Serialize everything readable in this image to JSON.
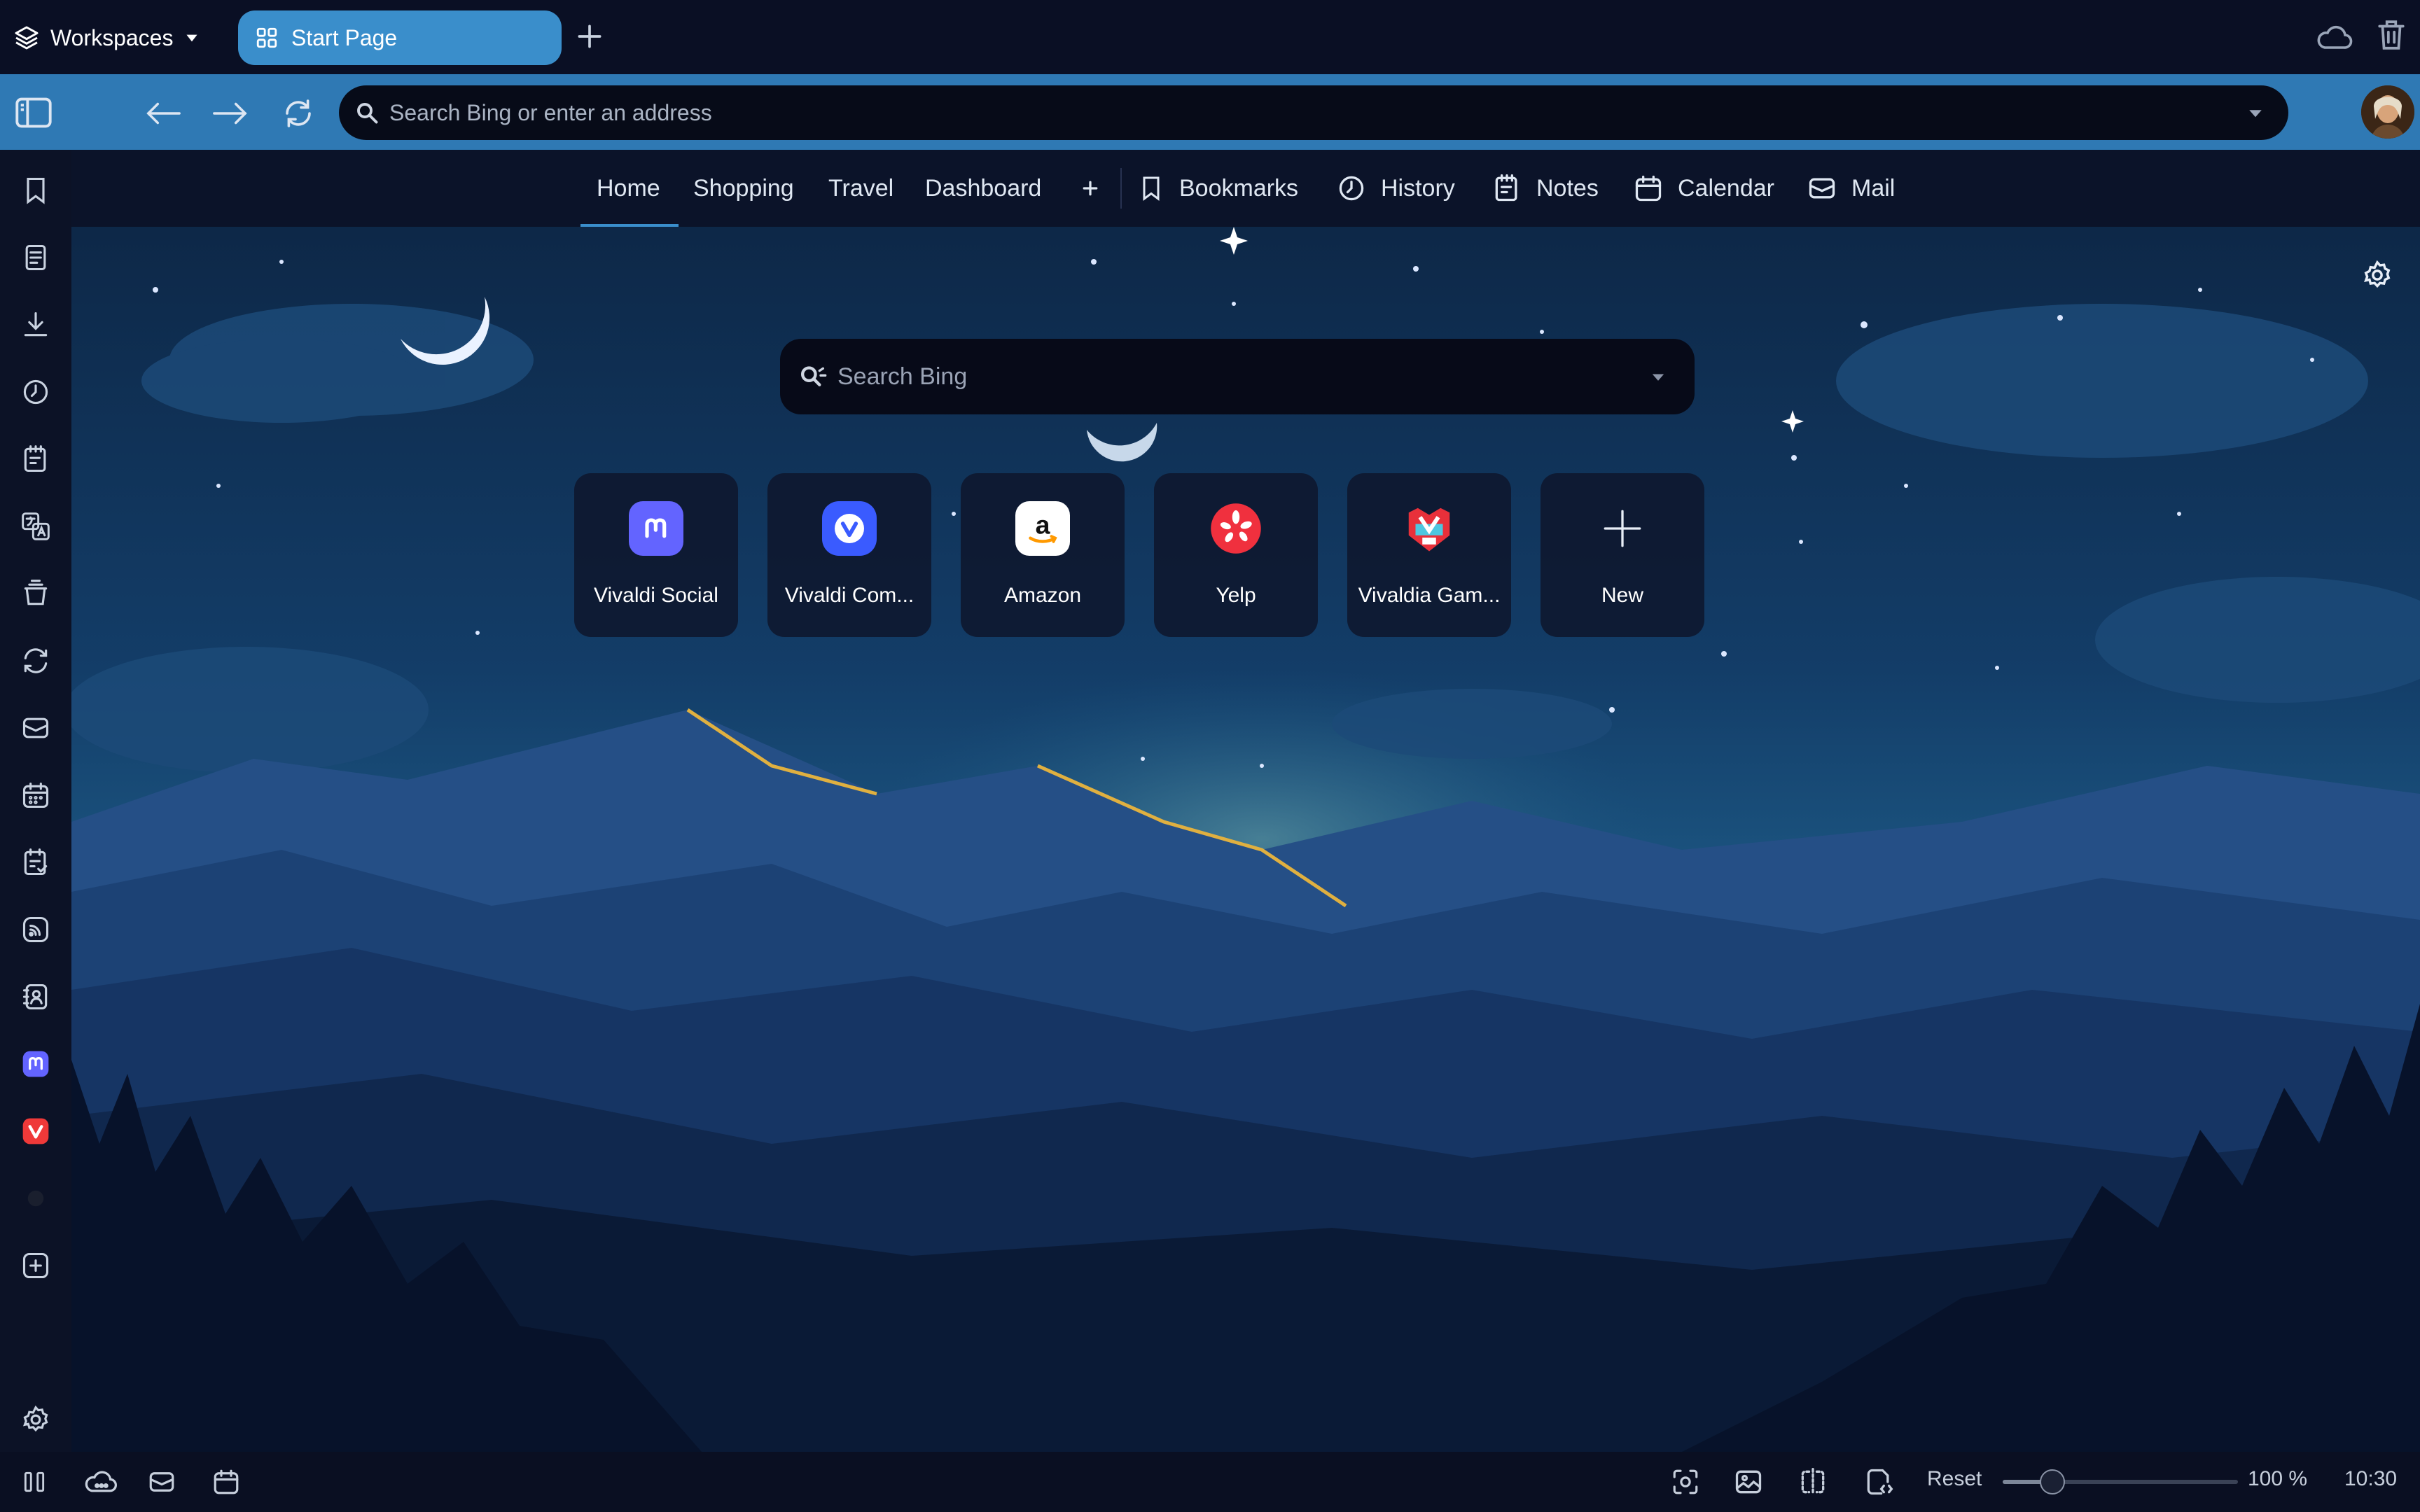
{
  "workspaces": {
    "label": "Workspaces"
  },
  "tab": {
    "label": "Start Page"
  },
  "address": {
    "placeholder": "Search Bing or enter an address"
  },
  "nav": {
    "tabs": [
      {
        "label": "Home",
        "active": true
      },
      {
        "label": "Shopping"
      },
      {
        "label": "Travel"
      },
      {
        "label": "Dashboard"
      }
    ],
    "shortcuts": [
      {
        "label": "Bookmarks",
        "icon": "bookmark-icon"
      },
      {
        "label": "History",
        "icon": "history-icon"
      },
      {
        "label": "Notes",
        "icon": "notes-icon"
      },
      {
        "label": "Calendar",
        "icon": "calendar-icon"
      },
      {
        "label": "Mail",
        "icon": "mail-icon"
      }
    ]
  },
  "search": {
    "placeholder": "Search Bing"
  },
  "speed_dials": [
    {
      "label": "Vivaldi Social",
      "icon": "mastodon-icon",
      "color": "#6364ff"
    },
    {
      "label": "Vivaldi Com...",
      "icon": "vivaldi-icon",
      "color": "#3a5bff"
    },
    {
      "label": "Amazon",
      "icon": "amazon-icon",
      "color": "#ffffff"
    },
    {
      "label": "Yelp",
      "icon": "yelp-icon",
      "color": "#f0303e"
    },
    {
      "label": "Vivaldia Gam...",
      "icon": "vivaldia-game-icon",
      "color": "#e8303a"
    },
    {
      "label": "New",
      "icon": "plus-icon"
    }
  ],
  "sidebar_panels": [
    "bookmarks-panel-icon",
    "reading-list-icon",
    "downloads-icon",
    "history-icon",
    "notes-icon",
    "translate-icon",
    "window-panel-icon",
    "sync-icon",
    "mail-icon",
    "calendar-icon",
    "tasks-icon",
    "feeds-icon",
    "contacts-icon",
    "mastodon-icon",
    "vivaldi-icon",
    "add-panel-icon",
    "settings-icon"
  ],
  "status": {
    "reset_label": "Reset",
    "zoom": "100 %",
    "zoom_level": 0.21,
    "clock": "10:30"
  },
  "colors": {
    "accent": "#3a8ecb",
    "address_bar": "#2f79b4",
    "chrome": "#0a0f24"
  }
}
